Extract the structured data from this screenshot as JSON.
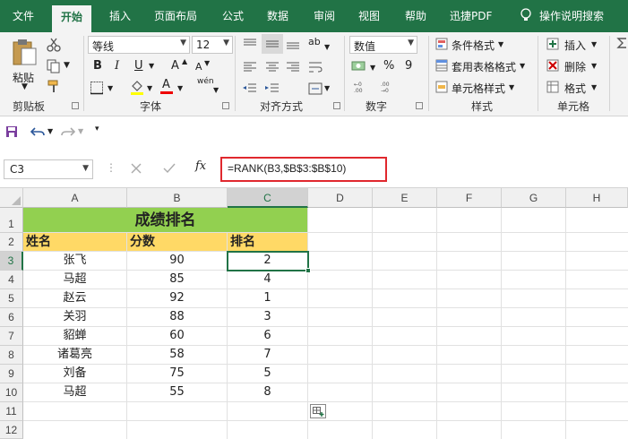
{
  "menu": {
    "tabs": [
      "文件",
      "开始",
      "插入",
      "页面布局",
      "公式",
      "数据",
      "审阅",
      "视图",
      "帮助",
      "迅捷PDF"
    ],
    "active_tab": "开始",
    "tell_me": "操作说明搜索"
  },
  "ribbon": {
    "clipboard": {
      "paste": "粘贴",
      "label": "剪贴板"
    },
    "font": {
      "name": "等线",
      "size": "12",
      "bold": "B",
      "italic": "I",
      "underline": "U",
      "grow": "A",
      "shrink": "A",
      "color_a": "A",
      "phonetic": "wén",
      "label": "字体"
    },
    "alignment": {
      "wrap": "ab",
      "label": "对齐方式"
    },
    "number": {
      "format": "数值",
      "percent": "%",
      "comma": "9",
      "label": "数字"
    },
    "styles": {
      "conditional": "条件格式",
      "table": "套用表格格式",
      "cell": "单元格样式",
      "label": "样式"
    },
    "cells": {
      "insert": "插入",
      "delete": "删除",
      "format": "格式",
      "label": "单元格"
    }
  },
  "formula_bar": {
    "name_box": "C3",
    "formula": "=RANK(B3,$B$3:$B$10)"
  },
  "grid": {
    "columns": [
      "A",
      "B",
      "C",
      "D",
      "E",
      "F",
      "G",
      "H"
    ],
    "rows": [
      "1",
      "2",
      "3",
      "4",
      "5",
      "6",
      "7",
      "8",
      "9",
      "10",
      "11",
      "12"
    ],
    "title": "成绩排名",
    "headers": [
      "姓名",
      "分数",
      "排名"
    ],
    "data": [
      [
        "张飞",
        "90",
        "2"
      ],
      [
        "马超",
        "85",
        "4"
      ],
      [
        "赵云",
        "92",
        "1"
      ],
      [
        "关羽",
        "88",
        "3"
      ],
      [
        "貂蝉",
        "60",
        "6"
      ],
      [
        "诸葛亮",
        "58",
        "7"
      ],
      [
        "刘备",
        "75",
        "5"
      ],
      [
        "马超",
        "55",
        "8"
      ]
    ]
  },
  "colors": {
    "accent": "#217346",
    "title_fill": "#92d050",
    "header_fill": "#ffd966",
    "formula_highlight": "#e0282e"
  }
}
